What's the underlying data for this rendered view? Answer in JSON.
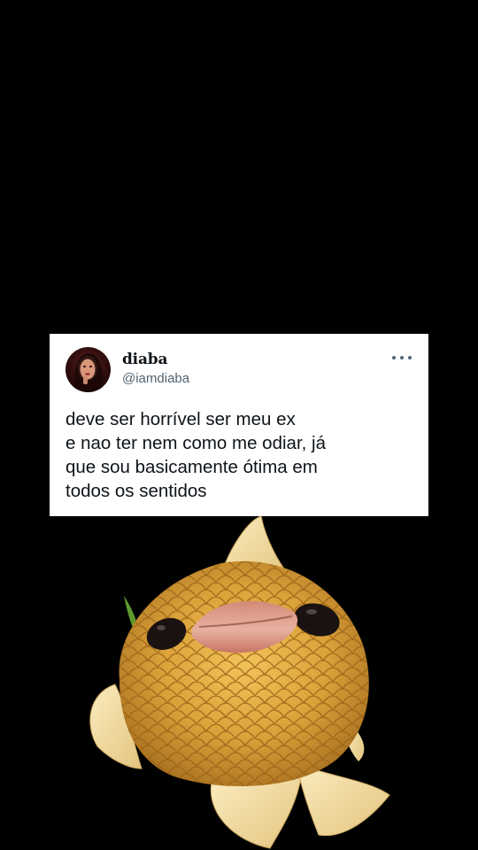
{
  "tweet": {
    "display_name": "diaba",
    "username": "@iamdiaba",
    "text": "deve ser horrível ser meu ex\ne nao ter nem como me odiar, já\nque sou basicamente ótima em\ntodos os sentidos",
    "more_icon": "more-horizontal-icon"
  },
  "sticker": {
    "subject": "goldfish-with-lips"
  },
  "colors": {
    "background": "#000000",
    "card": "#ffffff",
    "text": "#0f1419",
    "secondary_text": "#536471",
    "fish_gold": "#e0a93a"
  }
}
